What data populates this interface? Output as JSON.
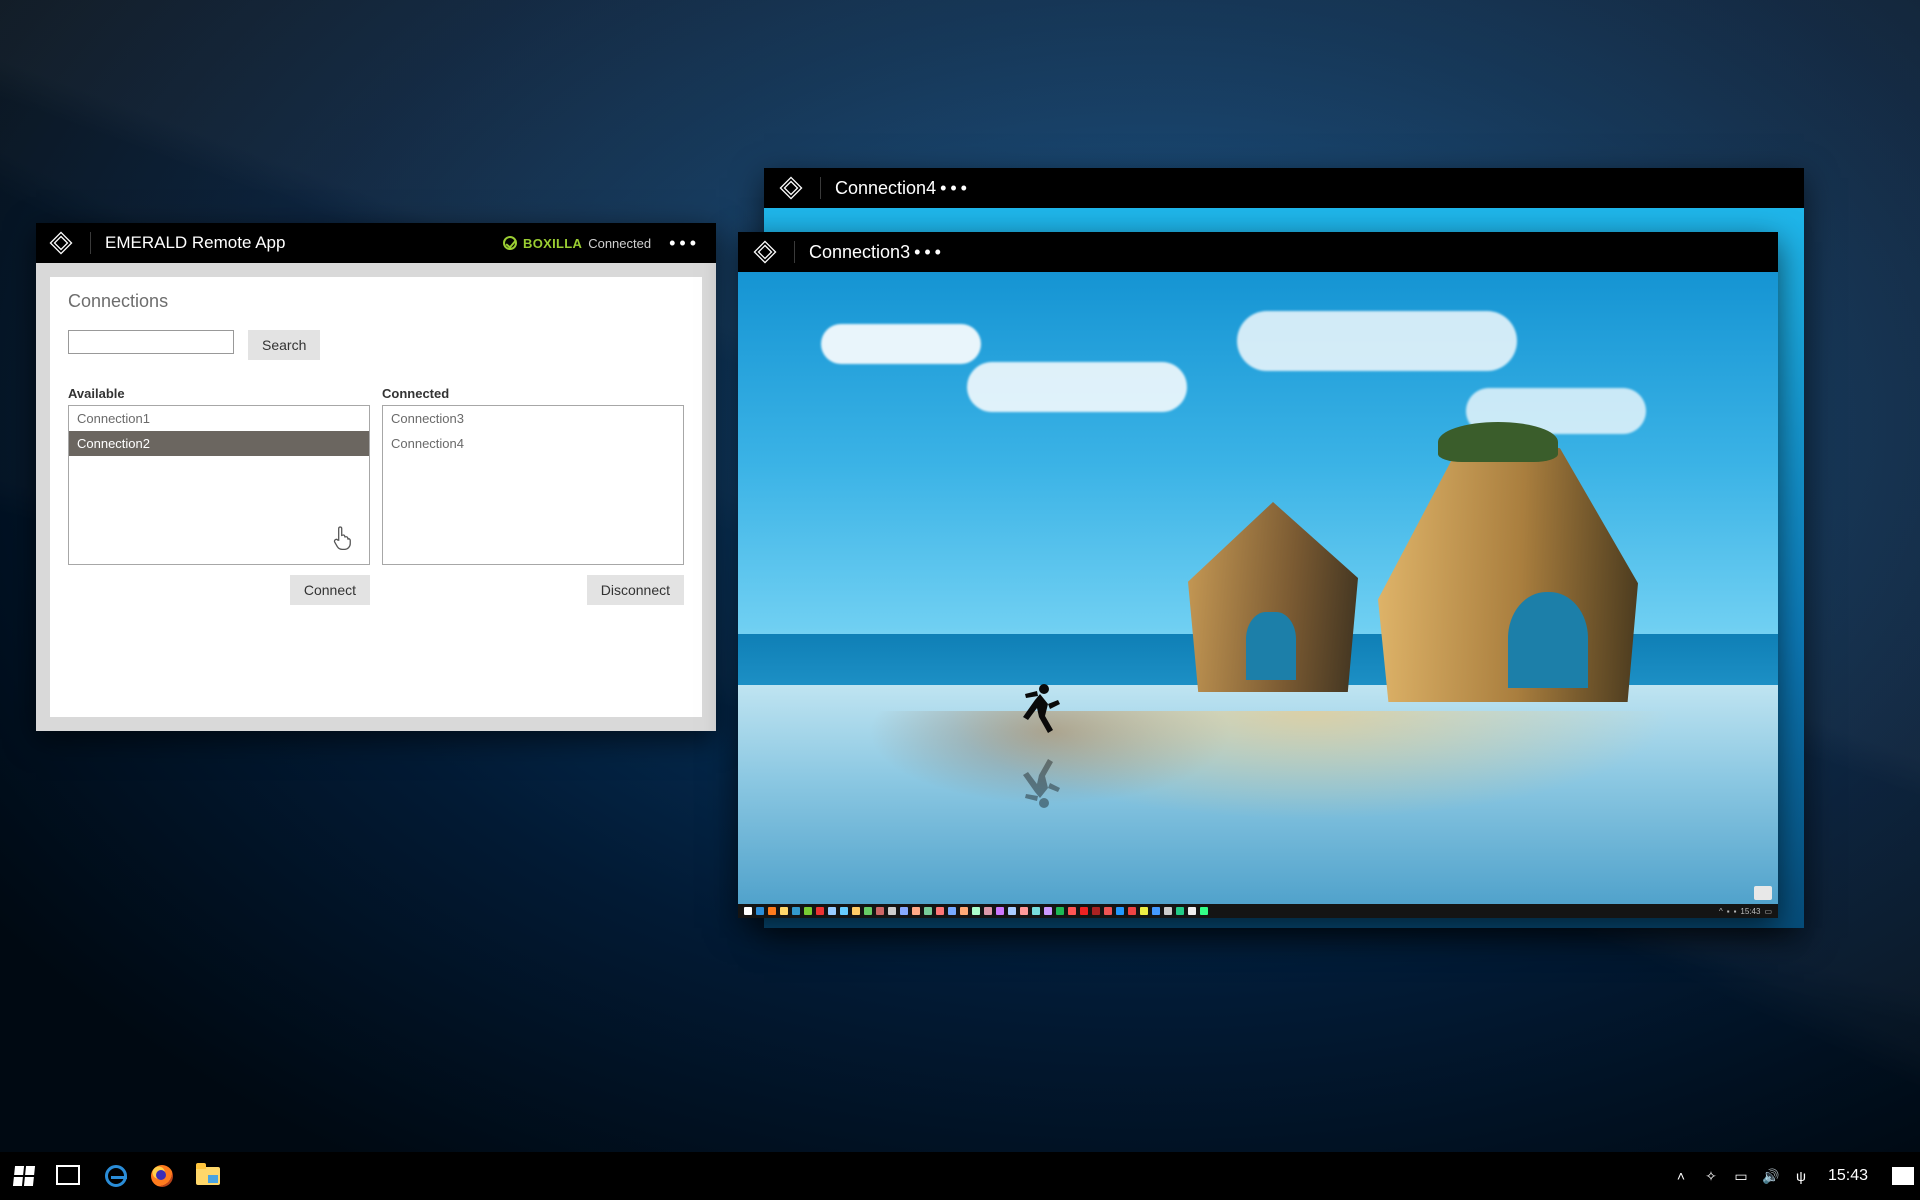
{
  "app": {
    "title": "EMERALD Remote App",
    "status_vendor": "BOXILLA",
    "status_text": "Connected",
    "panel_title": "Connections",
    "search_button": "Search",
    "available_label": "Available",
    "connected_label": "Connected",
    "connect_button": "Connect",
    "disconnect_button": "Disconnect",
    "available_items": [
      "Connection1",
      "Connection2"
    ],
    "available_selected_index": 1,
    "connected_items": [
      "Connection3",
      "Connection4"
    ]
  },
  "remote_windows": {
    "win4_title": "Connection4",
    "win3_title": "Connection3",
    "mini_clock": "15:43"
  },
  "taskbar": {
    "clock": "15:43",
    "tray_icons": [
      "chevron-up-icon",
      "dropbox-icon",
      "battery-icon",
      "volume-icon",
      "usb-icon"
    ]
  },
  "mini_taskbar_colors": [
    "#fff",
    "#2a8dd8",
    "#ff7b1d",
    "#ffd76a",
    "#39c",
    "#7c3",
    "#e33",
    "#9cf",
    "#6cf",
    "#fc6",
    "#6c6",
    "#c66",
    "#ccc",
    "#8af",
    "#fa8",
    "#7c9",
    "#f77",
    "#7af",
    "#fa7",
    "#afc",
    "#d9a",
    "#c7f",
    "#acf",
    "#f99",
    "#7dd",
    "#c9f",
    "#1DB954",
    "#f55",
    "#e22",
    "#a22",
    "#e55",
    "#29f",
    "#e44",
    "#ee4",
    "#49f",
    "#ccc",
    "#2c8",
    "#eee",
    "#3f8"
  ]
}
